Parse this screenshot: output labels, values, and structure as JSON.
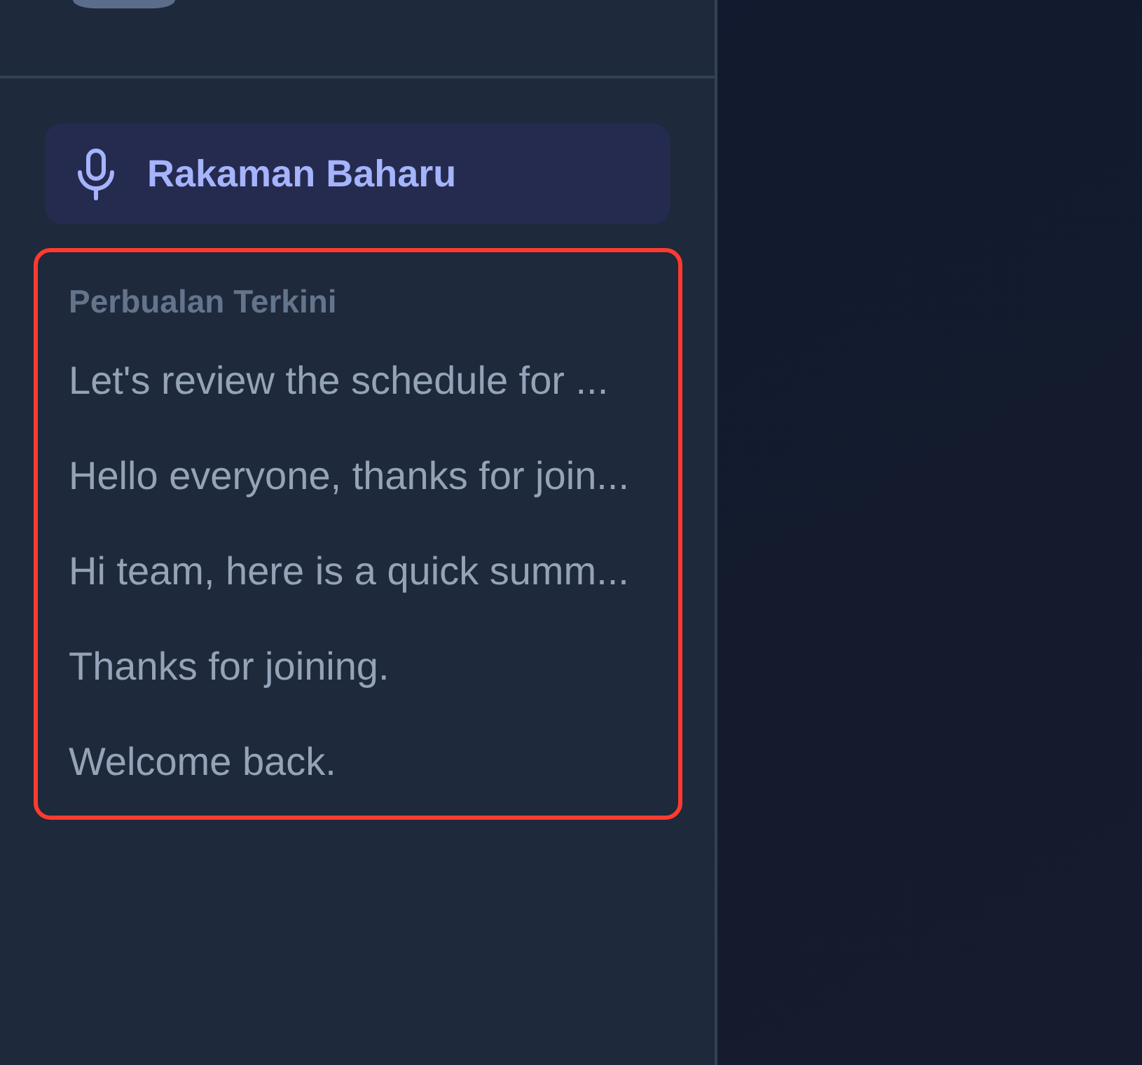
{
  "new_recording_button": {
    "label": "Rakaman Baharu"
  },
  "recent_conversations": {
    "heading": "Perbualan Terkini",
    "highlighted": true,
    "items": [
      {
        "title": "Let's review the schedule for ..."
      },
      {
        "title": "Hello everyone, thanks for join..."
      },
      {
        "title": "Hi team, here is a quick summ..."
      },
      {
        "title": "Thanks for joining."
      },
      {
        "title": "Welcome back."
      }
    ]
  }
}
